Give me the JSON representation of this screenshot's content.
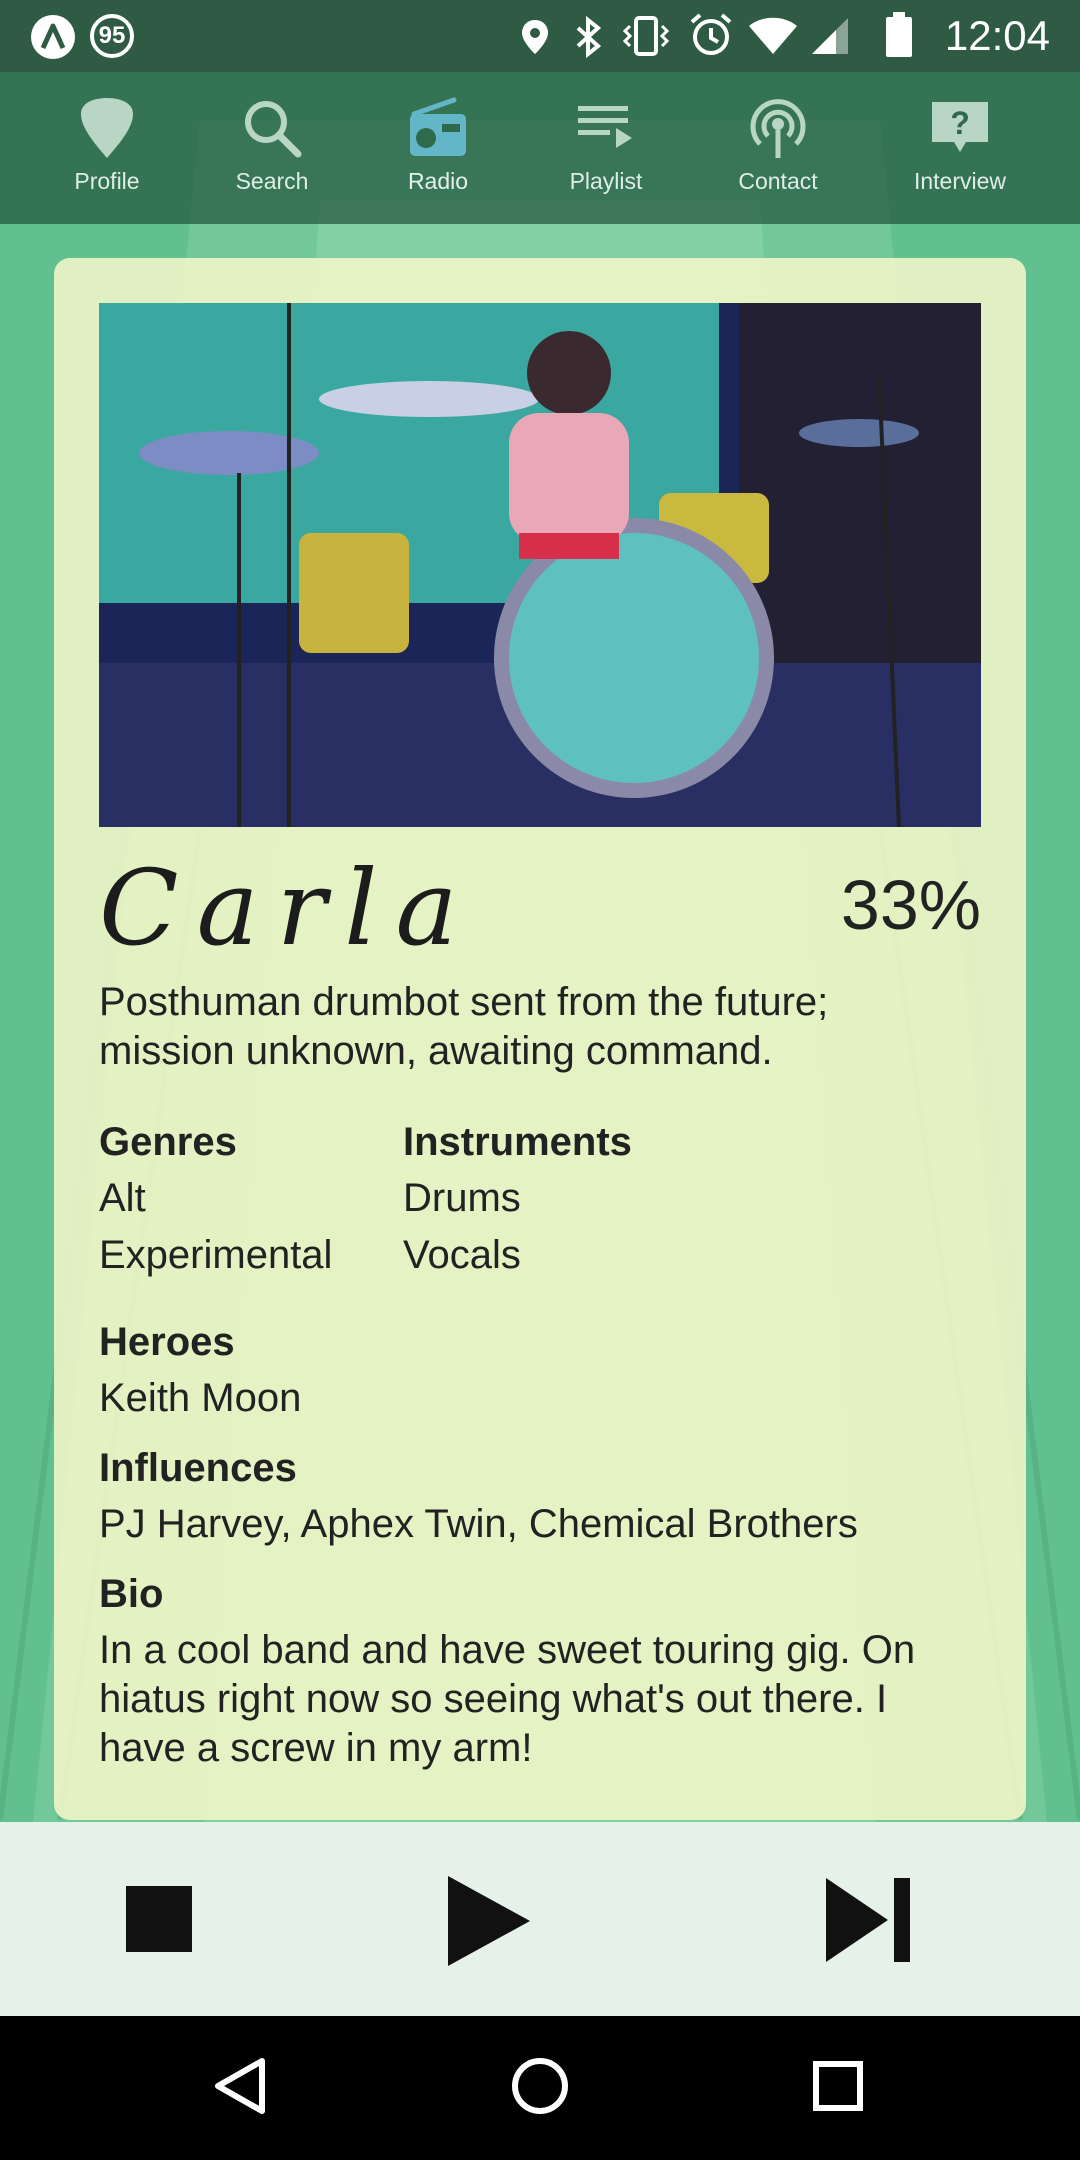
{
  "status_bar": {
    "notification_count": "95",
    "time": "12:04",
    "icons": [
      "app-logo-icon",
      "notification-count-badge",
      "location-icon",
      "bluetooth-icon",
      "vibrate-icon",
      "alarm-icon",
      "wifi-icon",
      "signal-icon",
      "battery-icon"
    ]
  },
  "nav": {
    "items": [
      {
        "label": "Profile",
        "icon": "guitar-pick-icon"
      },
      {
        "label": "Search",
        "icon": "search-icon"
      },
      {
        "label": "Radio",
        "icon": "radio-icon"
      },
      {
        "label": "Playlist",
        "icon": "playlist-icon"
      },
      {
        "label": "Contact",
        "icon": "broadcast-icon"
      },
      {
        "label": "Interview",
        "icon": "question-bubble-icon"
      }
    ],
    "active_index": 2
  },
  "profile": {
    "name": "Carla",
    "match_percent": "33%",
    "tagline": "Posthuman drumbot sent from the future; mission unknown, awaiting command.",
    "genres_heading": "Genres",
    "genres": [
      "Alt",
      "Experimental"
    ],
    "instruments_heading": "Instruments",
    "instruments": [
      "Drums",
      "Vocals"
    ],
    "heroes_heading": "Heroes",
    "heroes": "Keith Moon",
    "influences_heading": "Influences",
    "influences": "PJ Harvey, Aphex Twin, Chemical Brothers",
    "bio_heading": "Bio",
    "bio": "In a cool band and have sweet touring gig. On hiatus right now so seeing what's out there. I have a screw in my arm!"
  },
  "player": {
    "controls": [
      "stop-icon",
      "play-icon",
      "skip-next-icon"
    ]
  },
  "system_nav": {
    "buttons": [
      "back-icon",
      "home-icon",
      "recents-icon"
    ]
  },
  "colors": {
    "status_bar": "#2f5a44",
    "nav_bar": "#2f6a4c",
    "card": "#eef3c8",
    "player": "#e6f1ea",
    "background": "#5cb887"
  }
}
